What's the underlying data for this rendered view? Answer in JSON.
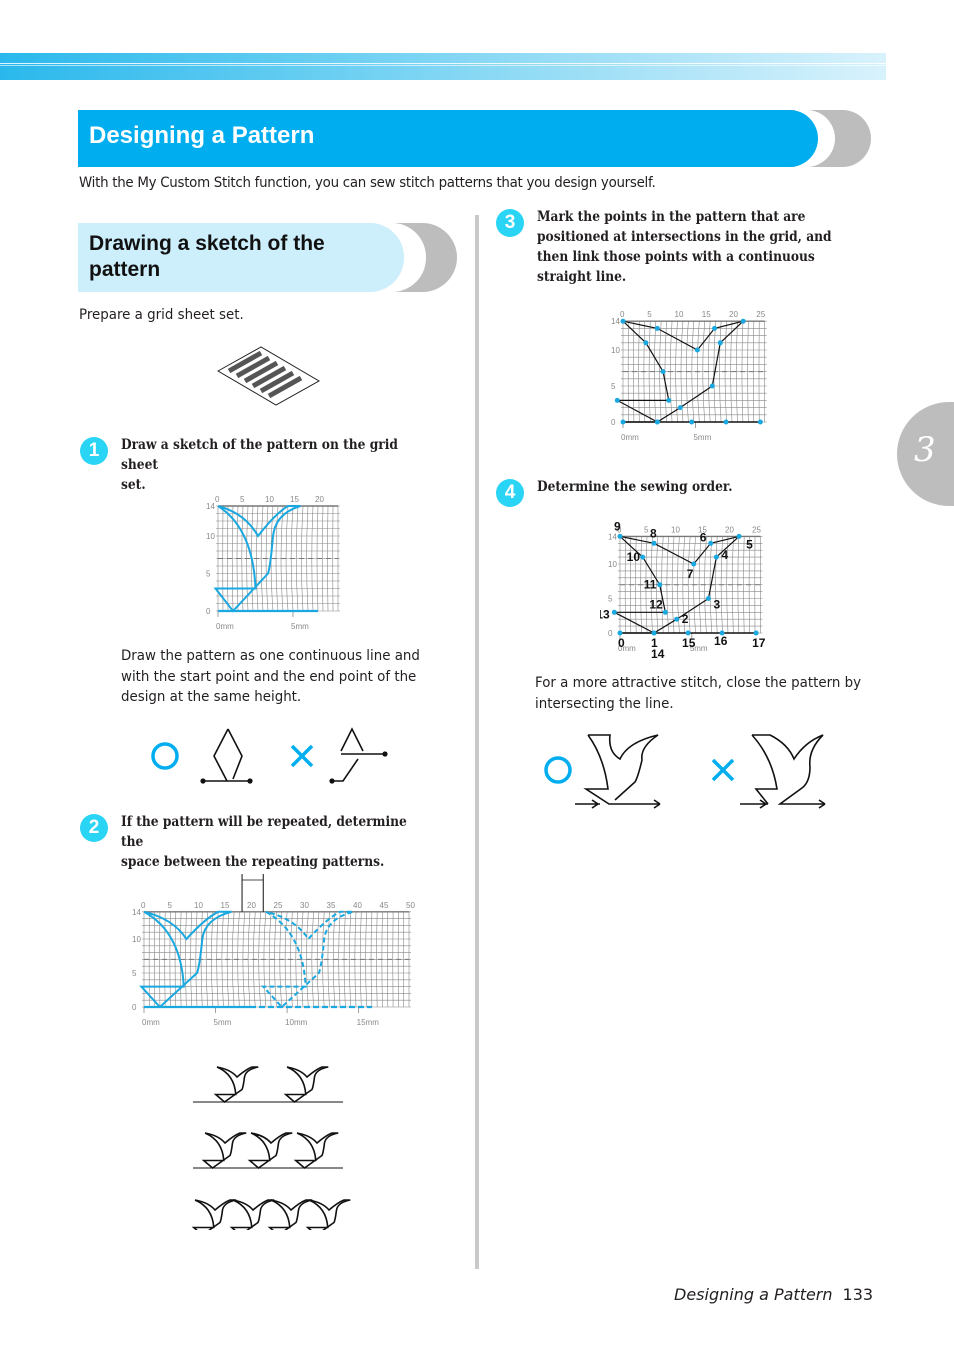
{
  "page": {
    "title": "Designing a Pattern",
    "intro": "With the My Custom Stitch function, you can sew stitch patterns that you design yourself.",
    "chapter_tab": "3",
    "footer": {
      "section": "Designing a Pattern",
      "page_number": "133"
    }
  },
  "section": {
    "title_line1": "Drawing a sketch of the",
    "title_line2": "pattern",
    "prepare_text": "Prepare a grid sheet set."
  },
  "steps": [
    {
      "number": "1",
      "text_line1": "Draw a sketch of the pattern on the grid sheet",
      "text_line2": "set.",
      "note_lines": [
        "Draw the pattern as one continuous line and",
        "with the start point and the end point of the",
        "design at the same height."
      ]
    },
    {
      "number": "2",
      "text_line1": "If the pattern will be repeated, determine the",
      "text_line2": "space between the repeating patterns."
    },
    {
      "number": "3",
      "text_lines": [
        "Mark the points in the pattern that are",
        "positioned at intersections in the grid, and",
        "then link those points with a continuous",
        "straight line."
      ]
    },
    {
      "number": "4",
      "text_line1": "Determine the sewing order.",
      "note_lines": [
        "For a more attractive stitch, close the pattern by",
        "intersecting the line."
      ]
    }
  ],
  "grid": {
    "x_ticks_short": [
      "0",
      "5",
      "10",
      "15",
      "20"
    ],
    "x_ticks_25": [
      "0",
      "5",
      "10",
      "15",
      "20",
      "25"
    ],
    "x_ticks_50": [
      "0",
      "5",
      "10",
      "15",
      "20",
      "25",
      "30",
      "35",
      "40",
      "45",
      "50"
    ],
    "y_ticks": [
      "0",
      "5",
      "10",
      "14"
    ],
    "mm_labels": [
      "0mm",
      "5mm"
    ],
    "mm_labels_long": [
      "0mm",
      "5mm",
      "10mm",
      "15mm"
    ]
  },
  "sewing_order_labels": [
    "0",
    "1",
    "2",
    "3",
    "4",
    "5",
    "6",
    "7",
    "8",
    "9",
    "10",
    "11",
    "12",
    "13",
    "14",
    "15",
    "16",
    "17"
  ],
  "marks": {
    "good": "○",
    "bad": "×"
  },
  "colors": {
    "accent": "#00aeef",
    "accent_light": "#cdeefb",
    "step_badge": "#2ad4f4",
    "tab_grey": "#bdbdbd"
  }
}
